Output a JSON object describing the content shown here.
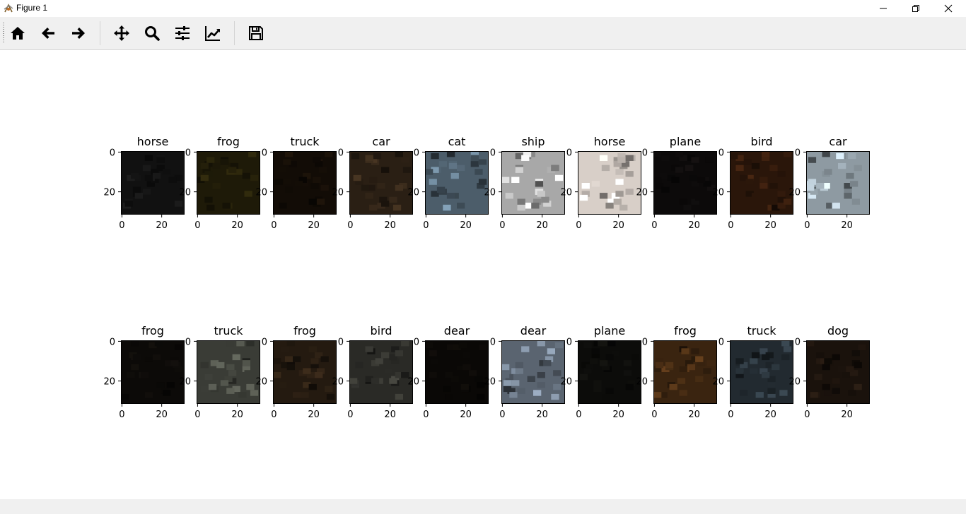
{
  "window": {
    "title": "Figure 1",
    "controls": [
      "minimize",
      "restore",
      "close"
    ]
  },
  "toolbar": {
    "buttons": [
      {
        "name": "home-icon",
        "tooltip": "Reset original view"
      },
      {
        "name": "back-arrow-icon",
        "tooltip": "Back to previous view"
      },
      {
        "name": "forward-arrow-icon",
        "tooltip": "Forward to next view"
      },
      {
        "name": "pan-icon",
        "tooltip": "Pan axes"
      },
      {
        "name": "zoom-icon",
        "tooltip": "Zoom to rectangle"
      },
      {
        "name": "configure-subplots-icon",
        "tooltip": "Configure subplots"
      },
      {
        "name": "edit-axis-icon",
        "tooltip": "Edit axis, curve and image parameters"
      },
      {
        "name": "save-icon",
        "tooltip": "Save the figure"
      }
    ]
  },
  "chart_data": {
    "type": "image-grid",
    "rows": 2,
    "cols": 10,
    "image_size": [
      32,
      32
    ],
    "xticks": [
      "0",
      "20"
    ],
    "yticks": [
      "0",
      "20"
    ],
    "titles": [
      [
        "horse",
        "frog",
        "truck",
        "car",
        "cat",
        "ship",
        "horse",
        "plane",
        "bird",
        "car"
      ],
      [
        "frog",
        "truck",
        "frog",
        "bird",
        "dear",
        "dear",
        "plane",
        "frog",
        "truck",
        "dog"
      ]
    ],
    "dominant_colors": [
      [
        "#111111",
        "#1e1a08",
        "#120c06",
        "#2a1f14",
        "#4c5d6a",
        "#a8a8a8",
        "#d8cfc8",
        "#0c0a0a",
        "#2a160a",
        "#8e9aa2"
      ],
      [
        "#0c0a08",
        "#3a3c36",
        "#241a10",
        "#2a2a26",
        "#0a0806",
        "#5a6470",
        "#0c0c0a",
        "#3a2410",
        "#222a30",
        "#1a120c"
      ]
    ]
  }
}
